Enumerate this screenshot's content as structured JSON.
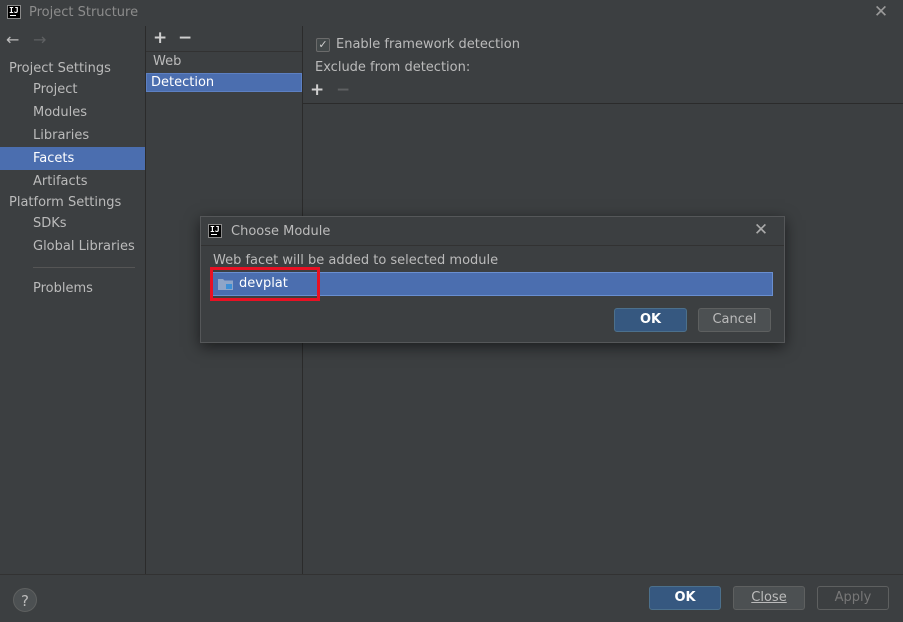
{
  "window": {
    "title": "Project Structure",
    "close_glyph": "✕",
    "logo_text": "IJ"
  },
  "nav": {
    "back_glyph": "←",
    "forward_glyph": "→",
    "sections": [
      {
        "label": "Project Settings"
      },
      {
        "label": "Platform Settings"
      }
    ],
    "items": [
      {
        "label": "Project"
      },
      {
        "label": "Modules"
      },
      {
        "label": "Libraries"
      },
      {
        "label": "Facets",
        "selected": true
      },
      {
        "label": "Artifacts"
      },
      {
        "label": "SDKs"
      },
      {
        "label": "Global Libraries"
      },
      {
        "label": "Problems"
      }
    ]
  },
  "facets": {
    "add_glyph": "+",
    "remove_glyph": "−",
    "items": [
      {
        "label": "Web"
      },
      {
        "label": "Detection",
        "selected": true
      }
    ]
  },
  "detection": {
    "enable_label": "Enable framework detection",
    "enabled": true,
    "check_glyph": "✓",
    "exclude_label": "Exclude from detection:",
    "add_glyph": "+",
    "remove_glyph": "−"
  },
  "dialog": {
    "title": "Choose Module",
    "close_glyph": "✕",
    "description": "Web facet will be added to selected module",
    "modules": [
      {
        "label": "devplat",
        "icon": "module-folder-icon",
        "selected": true
      }
    ],
    "ok_label": "OK",
    "cancel_label": "Cancel",
    "highlight_color": "#e81123"
  },
  "footer": {
    "help_glyph": "?",
    "ok_label": "OK",
    "close_label": "Close",
    "apply_label": "Apply"
  },
  "colors": {
    "background": "#3c3f41",
    "selection": "#4b6eaf",
    "primary_button": "#365880"
  }
}
